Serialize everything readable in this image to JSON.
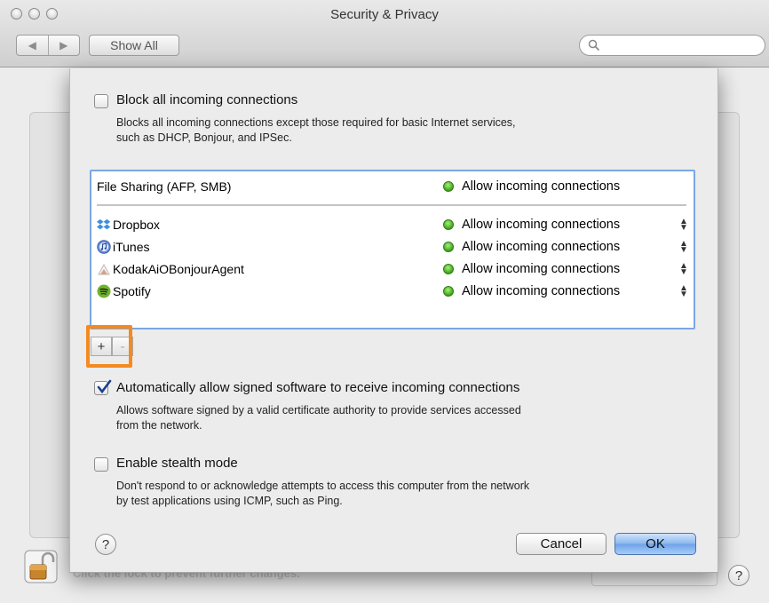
{
  "window": {
    "title": "Security & Privacy",
    "show_all_label": "Show All"
  },
  "background": {
    "lock_text": "Click the lock to prevent further changes.",
    "help": "?"
  },
  "sheet": {
    "block_all": {
      "label": "Block all incoming connections",
      "desc_line1": "Blocks all incoming connections except those required for basic Internet services,",
      "desc_line2": "such as DHCP, Bonjour, and IPSec.",
      "checked": false
    },
    "service_row": {
      "name": "File Sharing (AFP, SMB)",
      "status": "Allow incoming connections"
    },
    "apps": [
      {
        "name": "Dropbox",
        "status": "Allow incoming connections",
        "icon": "dropbox-icon"
      },
      {
        "name": "iTunes",
        "status": "Allow incoming connections",
        "icon": "itunes-icon"
      },
      {
        "name": "KodakAiOBonjourAgent",
        "status": "Allow incoming connections",
        "icon": "kodak-icon"
      },
      {
        "name": "Spotify",
        "status": "Allow incoming connections",
        "icon": "spotify-icon"
      }
    ],
    "add_label": "+",
    "remove_label": "-",
    "signed_software": {
      "label": "Automatically allow signed software to receive incoming connections",
      "desc_line1": "Allows software signed by a valid certificate authority to provide services accessed",
      "desc_line2": "from the network.",
      "checked": true
    },
    "stealth": {
      "label": "Enable stealth mode",
      "desc_line1": "Don't respond to or acknowledge attempts to access this computer from the network",
      "desc_line2": "by test applications using ICMP, such as Ping.",
      "checked": false
    },
    "help": "?",
    "cancel_label": "Cancel",
    "ok_label": "OK"
  },
  "colors": {
    "highlight": "#f48a20",
    "status_green": "#3ea11b",
    "list_border": "#7aa7e3"
  }
}
